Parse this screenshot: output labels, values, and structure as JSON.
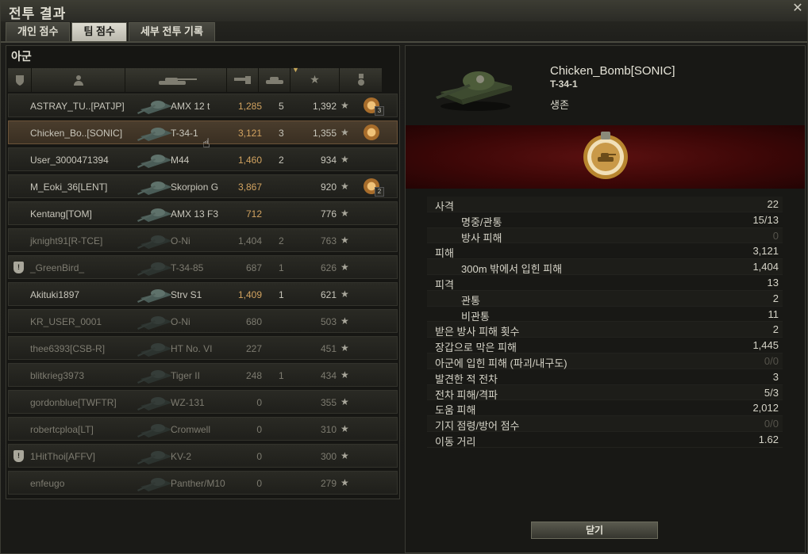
{
  "window": {
    "title": "전투 결과"
  },
  "tabs": [
    {
      "label": "개인 점수",
      "active": false
    },
    {
      "label": "팀 점수",
      "active": true
    },
    {
      "label": "세부 전투 기록",
      "active": false
    }
  ],
  "team": {
    "title": "아군",
    "columns": [
      "clan",
      "player",
      "vehicle",
      "damage",
      "kills",
      "xp",
      "medals"
    ],
    "rows": [
      {
        "player": "ASTRAY_TU..[PATJP]",
        "vehicle": "AMX 12 t",
        "damage": "1,285",
        "kills": "5",
        "xp": "1,392",
        "medal": true,
        "medal_count": "3",
        "alive": true,
        "selected": false
      },
      {
        "player": "Chicken_Bo..[SONIC]",
        "vehicle": "T-34-1",
        "damage": "3,121",
        "kills": "3",
        "xp": "1,355",
        "medal": true,
        "medal_count": "",
        "alive": true,
        "selected": true
      },
      {
        "player": "User_3000471394",
        "vehicle": "M44",
        "damage": "1,460",
        "kills": "2",
        "xp": "934",
        "medal": false,
        "medal_count": "",
        "alive": true,
        "selected": false
      },
      {
        "player": "M_Eoki_36[LENT]",
        "vehicle": "Skorpion G",
        "damage": "3,867",
        "kills": "",
        "xp": "920",
        "medal": true,
        "medal_count": "2",
        "alive": true,
        "selected": false
      },
      {
        "player": "Kentang[TOM]",
        "vehicle": "AMX 13 F3",
        "damage": "712",
        "kills": "",
        "xp": "776",
        "medal": false,
        "medal_count": "",
        "alive": true,
        "selected": false
      },
      {
        "player": "jknight91[R-TCE]",
        "vehicle": "O-Ni",
        "damage": "1,404",
        "kills": "2",
        "xp": "763",
        "medal": false,
        "medal_count": "",
        "alive": false,
        "selected": false
      },
      {
        "player": "_GreenBird_",
        "vehicle": "T-34-85",
        "damage": "687",
        "kills": "1",
        "xp": "626",
        "medal": false,
        "medal_count": "",
        "alive": false,
        "selected": false,
        "clan_icon": true
      },
      {
        "player": "Akituki1897",
        "vehicle": "Strv S1",
        "damage": "1,409",
        "kills": "1",
        "xp": "621",
        "medal": false,
        "medal_count": "",
        "alive": true,
        "selected": false
      },
      {
        "player": "KR_USER_0001",
        "vehicle": "O-Ni",
        "damage": "680",
        "kills": "",
        "xp": "503",
        "medal": false,
        "medal_count": "",
        "alive": false,
        "selected": false
      },
      {
        "player": "thee6393[CSB-R]",
        "vehicle": "HT No. VI",
        "damage": "227",
        "kills": "",
        "xp": "451",
        "medal": false,
        "medal_count": "",
        "alive": false,
        "selected": false
      },
      {
        "player": "blitkrieg3973",
        "vehicle": "Tiger II",
        "damage": "248",
        "kills": "1",
        "xp": "434",
        "medal": false,
        "medal_count": "",
        "alive": false,
        "selected": false
      },
      {
        "player": "gordonblue[TWFTR]",
        "vehicle": "WZ-131",
        "damage": "0",
        "kills": "",
        "xp": "355",
        "medal": false,
        "medal_count": "",
        "alive": false,
        "selected": false
      },
      {
        "player": "robertcploa[LT]",
        "vehicle": "Cromwell",
        "damage": "0",
        "kills": "",
        "xp": "310",
        "medal": false,
        "medal_count": "",
        "alive": false,
        "selected": false
      },
      {
        "player": "1HitThoi[AFFV]",
        "vehicle": "KV-2",
        "damage": "0",
        "kills": "",
        "xp": "300",
        "medal": false,
        "medal_count": "",
        "alive": false,
        "selected": false,
        "clan_icon": true
      },
      {
        "player": "enfeugo",
        "vehicle": "Panther/M10",
        "damage": "0",
        "kills": "",
        "xp": "279",
        "medal": false,
        "medal_count": "",
        "alive": false,
        "selected": false
      }
    ]
  },
  "detail": {
    "player": "Chicken_Bomb[SONIC]",
    "vehicle": "T-34-1",
    "status": "생존",
    "stats": [
      {
        "label": "사격",
        "value": "22",
        "sub": false,
        "dim": false
      },
      {
        "label": "명중/관통",
        "value": "15/13",
        "sub": true,
        "dim": false
      },
      {
        "label": "방사 피해",
        "value": "0",
        "sub": true,
        "dim": true
      },
      {
        "label": "피해",
        "value": "3,121",
        "sub": false,
        "dim": false
      },
      {
        "label": "300m 밖에서 입힌 피해",
        "value": "1,404",
        "sub": true,
        "dim": false
      },
      {
        "label": "피격",
        "value": "13",
        "sub": false,
        "dim": false
      },
      {
        "label": "관통",
        "value": "2",
        "sub": true,
        "dim": false
      },
      {
        "label": "비관통",
        "value": "11",
        "sub": true,
        "dim": false
      },
      {
        "label": "받은 방사 피해 횟수",
        "value": "2",
        "sub": false,
        "dim": false
      },
      {
        "label": "장갑으로 막은 피해",
        "value": "1,445",
        "sub": false,
        "dim": false
      },
      {
        "label": "아군에 입힌 피해 (파괴/내구도)",
        "value": "0/0",
        "sub": false,
        "dim": true
      },
      {
        "label": "발견한 적 전차",
        "value": "3",
        "sub": false,
        "dim": false
      },
      {
        "label": "전차 피해/격파",
        "value": "5/3",
        "sub": false,
        "dim": false
      },
      {
        "label": "도움 피해",
        "value": "2,012",
        "sub": false,
        "dim": false
      },
      {
        "label": "기지 점령/방어 점수",
        "value": "0/0",
        "sub": false,
        "dim": true
      },
      {
        "label": "이동 거리",
        "value": "1.62",
        "sub": false,
        "dim": false
      }
    ],
    "close_label": "닫기"
  },
  "icons": {
    "close": "close-icon",
    "clan_header": "shield-icon",
    "player_header": "person-icon",
    "vehicle_header": "tank-icon",
    "damage_header": "gun-icon",
    "kills_header": "destroyed-tank-icon",
    "xp_header": "star-icon",
    "medals_header": "medal-icon"
  }
}
